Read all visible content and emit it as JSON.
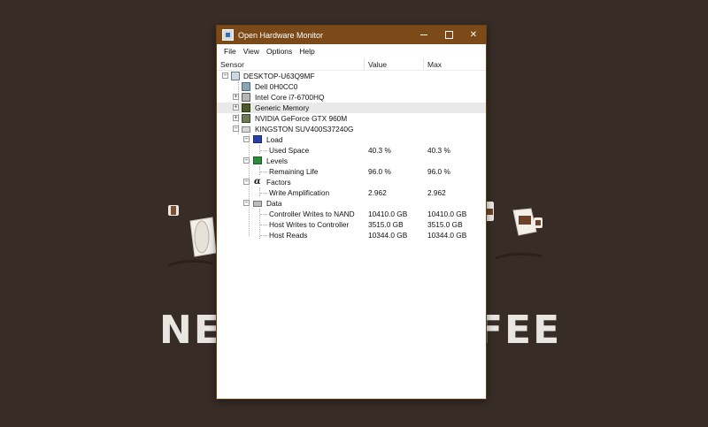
{
  "wallpaper": {
    "text_left": "NE",
    "text_right": "FEE"
  },
  "window": {
    "title": "Open Hardware Monitor",
    "menu": [
      "File",
      "View",
      "Options",
      "Help"
    ],
    "columns": {
      "sensor": "Sensor",
      "value": "Value",
      "max": "Max"
    },
    "tree": {
      "root": "DESKTOP-U63Q9MF",
      "devices": [
        "Dell 0H0CC0",
        "Intel Core i7-6700HQ",
        "Generic Memory",
        "NVIDIA GeForce GTX 960M",
        "KINGSTON SUV400S37240G"
      ],
      "groups": {
        "load": "Load",
        "levels": "Levels",
        "factors": "Factors",
        "data": "Data"
      },
      "sensors": [
        {
          "name": "Used Space",
          "value": "40.3 %",
          "max": "40.3 %"
        },
        {
          "name": "Remaining Life",
          "value": "96.0 %",
          "max": "96.0 %"
        },
        {
          "name": "Write Amplification",
          "value": "2.962",
          "max": "2.962"
        },
        {
          "name": "Controller Writes to NAND",
          "value": "10410.0 GB",
          "max": "10410.0 GB"
        },
        {
          "name": "Host Writes to Controller",
          "value": "3515.0 GB",
          "max": "3515.0 GB"
        },
        {
          "name": "Host Reads",
          "value": "10344.0 GB",
          "max": "10344.0 GB"
        }
      ]
    }
  }
}
